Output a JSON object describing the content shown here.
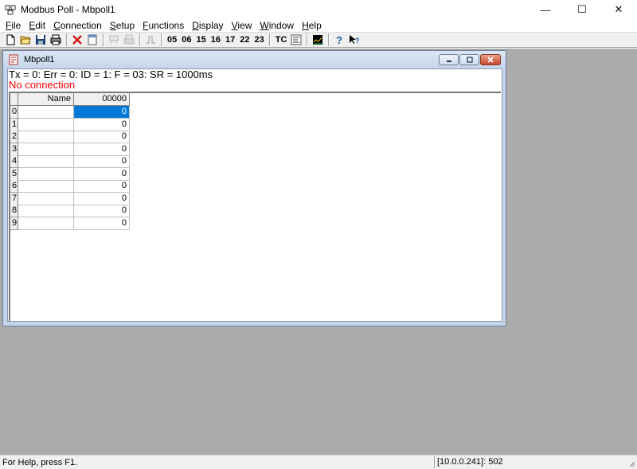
{
  "window": {
    "title": "Modbus Poll - Mbpoll1"
  },
  "menu": [
    "File",
    "Edit",
    "Connection",
    "Setup",
    "Functions",
    "Display",
    "View",
    "Window",
    "Help"
  ],
  "toolbar": {
    "function_codes": [
      "05",
      "06",
      "15",
      "16",
      "17",
      "22",
      "23"
    ],
    "tc_label": "TC"
  },
  "child": {
    "title": "Mbpoll1",
    "status": "Tx = 0: Err = 0: ID = 1: F = 03: SR = 1000ms",
    "connection": "No connection",
    "columns": {
      "name": "Name",
      "address": "00000"
    },
    "rows": [
      {
        "index": "0",
        "name": "",
        "value": "0"
      },
      {
        "index": "1",
        "name": "",
        "value": "0"
      },
      {
        "index": "2",
        "name": "",
        "value": "0"
      },
      {
        "index": "3",
        "name": "",
        "value": "0"
      },
      {
        "index": "4",
        "name": "",
        "value": "0"
      },
      {
        "index": "5",
        "name": "",
        "value": "0"
      },
      {
        "index": "6",
        "name": "",
        "value": "0"
      },
      {
        "index": "7",
        "name": "",
        "value": "0"
      },
      {
        "index": "8",
        "name": "",
        "value": "0"
      },
      {
        "index": "9",
        "name": "",
        "value": "0"
      }
    ]
  },
  "statusbar": {
    "help": "For Help, press F1.",
    "connection": "[10.0.0.241]: 502"
  },
  "colors": {
    "selection": "#0078d7",
    "error_text": "#ff0000",
    "workspace": "#ababab"
  }
}
